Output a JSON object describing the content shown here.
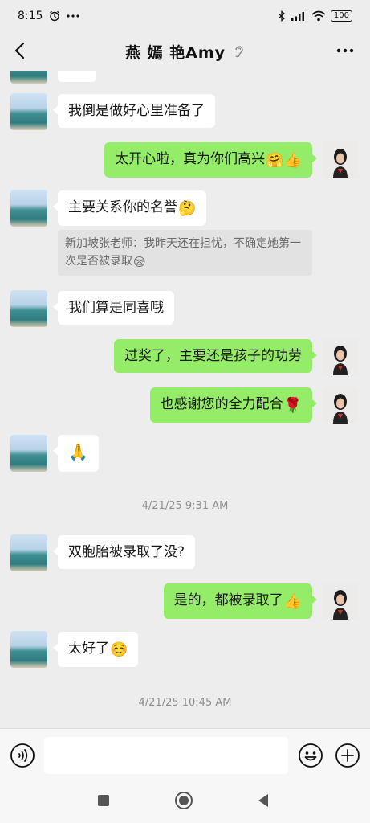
{
  "status": {
    "time": "8:15",
    "battery": "100"
  },
  "header": {
    "title": "燕 嫣 艳Amy"
  },
  "messages": {
    "m1": {
      "text": "我倒是做好心里准备了"
    },
    "m2": {
      "text": "太开心啦，真为你们高兴",
      "emoji": "🤗👍"
    },
    "m3": {
      "text": "主要关系你的名誉",
      "emoji": "🤔"
    },
    "m3_quote": {
      "text": "新加坡张老师：我昨天还在担忧，不确定她第一次是否被录取",
      "emoji": "😪"
    },
    "m4": {
      "text": "我们算是同喜哦"
    },
    "m5": {
      "text": "过奖了，主要还是孩子的功劳"
    },
    "m6": {
      "text": "也感谢您的全力配合",
      "emoji": "🌹"
    },
    "m7": {
      "emoji": "🙏"
    },
    "ts1": "4/21/25 9:31 AM",
    "m8": {
      "text": "双胞胎被录取了没?"
    },
    "m9": {
      "text": "是的，都被录取了",
      "emoji": "👍"
    },
    "m10": {
      "text": "太好了",
      "emoji": "☺️"
    },
    "ts2": "4/21/25 10:45 AM"
  },
  "input": {
    "value": "",
    "placeholder": ""
  },
  "icons": {
    "alarm": "alarm-icon",
    "dots": "more-dots-icon",
    "bluetooth": "bluetooth-icon",
    "signal": "signal-icon",
    "wifi": "wifi-icon",
    "back": "back-arrow-icon",
    "ear": "earpiece-icon",
    "more": "more-options-icon",
    "voice": "voice-input-icon",
    "emoji": "emoji-icon",
    "plus": "plus-icon",
    "nav_square": "recent-apps-icon",
    "nav_circle": "home-icon",
    "nav_back": "nav-back-icon"
  },
  "colors": {
    "background": "#ededed",
    "outgoing_bubble": "#95ec69",
    "incoming_bubble": "#ffffff"
  }
}
